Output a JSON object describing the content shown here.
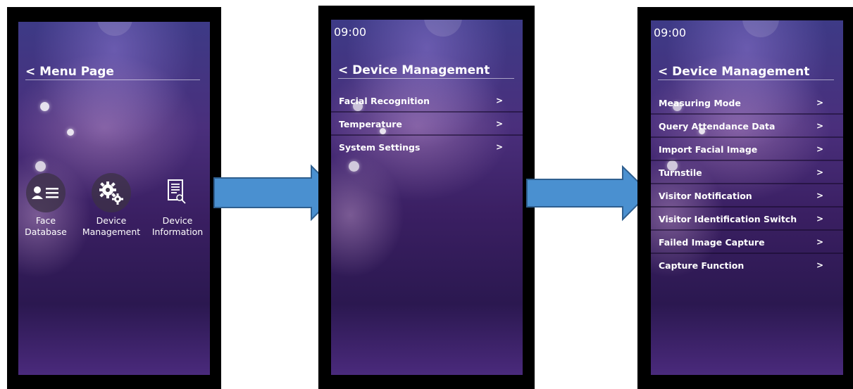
{
  "screen1": {
    "title": "< Menu Page",
    "icons": [
      {
        "icon": "face-database-icon",
        "line1": "Face",
        "line2": "Database"
      },
      {
        "icon": "gears-icon",
        "line1": "Device",
        "line2": "Management"
      },
      {
        "icon": "document-search-icon",
        "line1": "Device",
        "line2": "Information"
      }
    ]
  },
  "screen2": {
    "time": "09:00",
    "title": "< Device Management",
    "items": [
      {
        "label": "Facial Recognition",
        "chevron": ">"
      },
      {
        "label": "Temperature",
        "chevron": ">"
      },
      {
        "label": "System Settings",
        "chevron": ">"
      }
    ]
  },
  "screen3": {
    "time": "09:00",
    "title": "< Device Management",
    "items": [
      {
        "label": "Measuring Mode",
        "chevron": ">"
      },
      {
        "label": "Query Attendance Data",
        "chevron": ">"
      },
      {
        "label": "Import Facial Image",
        "chevron": ">"
      },
      {
        "label": "Turnstile",
        "chevron": ">"
      },
      {
        "label": "Visitor Notification",
        "chevron": ">"
      },
      {
        "label": "Visitor Identification Switch",
        "chevron": ">"
      },
      {
        "label": "Failed Image Capture",
        "chevron": ">"
      },
      {
        "label": "Capture Function",
        "chevron": ">"
      }
    ]
  },
  "colors": {
    "arrow_fill": "#4a90d0",
    "arrow_stroke": "#2f5f8f",
    "device_bezel": "#000000"
  }
}
